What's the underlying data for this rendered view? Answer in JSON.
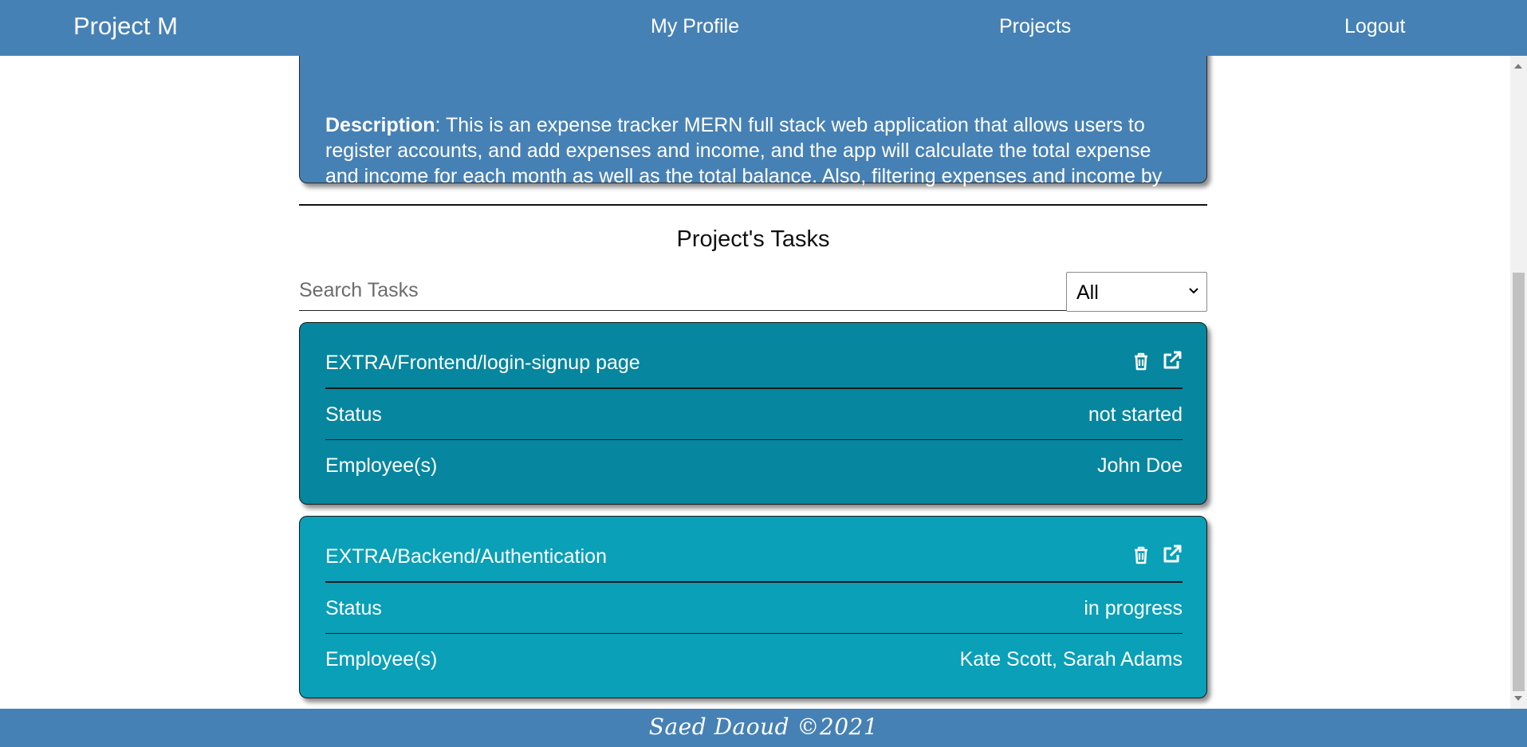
{
  "navbar": {
    "brand": "Project M",
    "links": [
      "My Profile",
      "Projects",
      "Logout"
    ]
  },
  "project": {
    "description_label": "Description",
    "description_text": ": This is an expense tracker MERN full stack web application that allows users to register accounts, and add expenses and income, and the app will calculate the total expense and income for each month as well as the total balance. Also, filtering expenses and income by month and year is available."
  },
  "tasks_section": {
    "title": "Project's Tasks",
    "search_placeholder": "Search Tasks",
    "filter_value": "All"
  },
  "tasks": [
    {
      "name": "EXTRA/Frontend/login-signup page",
      "status_label": "Status",
      "status": "not started",
      "employees_label": "Employee(s)",
      "employees": "John Doe",
      "color": "#06869f"
    },
    {
      "name": "EXTRA/Backend/Authentication",
      "status_label": "Status",
      "status": "in progress",
      "employees_label": "Employee(s)",
      "employees": "Kate Scott, Sarah Adams",
      "color": "#09a0b8"
    }
  ],
  "icons": {
    "delete": "trash-icon",
    "open": "external-link-icon"
  },
  "footer": {
    "text": "Saed Daoud ©2021"
  },
  "colors": {
    "primary": "#4681b5",
    "task_not_started": "#06869f",
    "task_in_progress": "#09a0b8"
  }
}
